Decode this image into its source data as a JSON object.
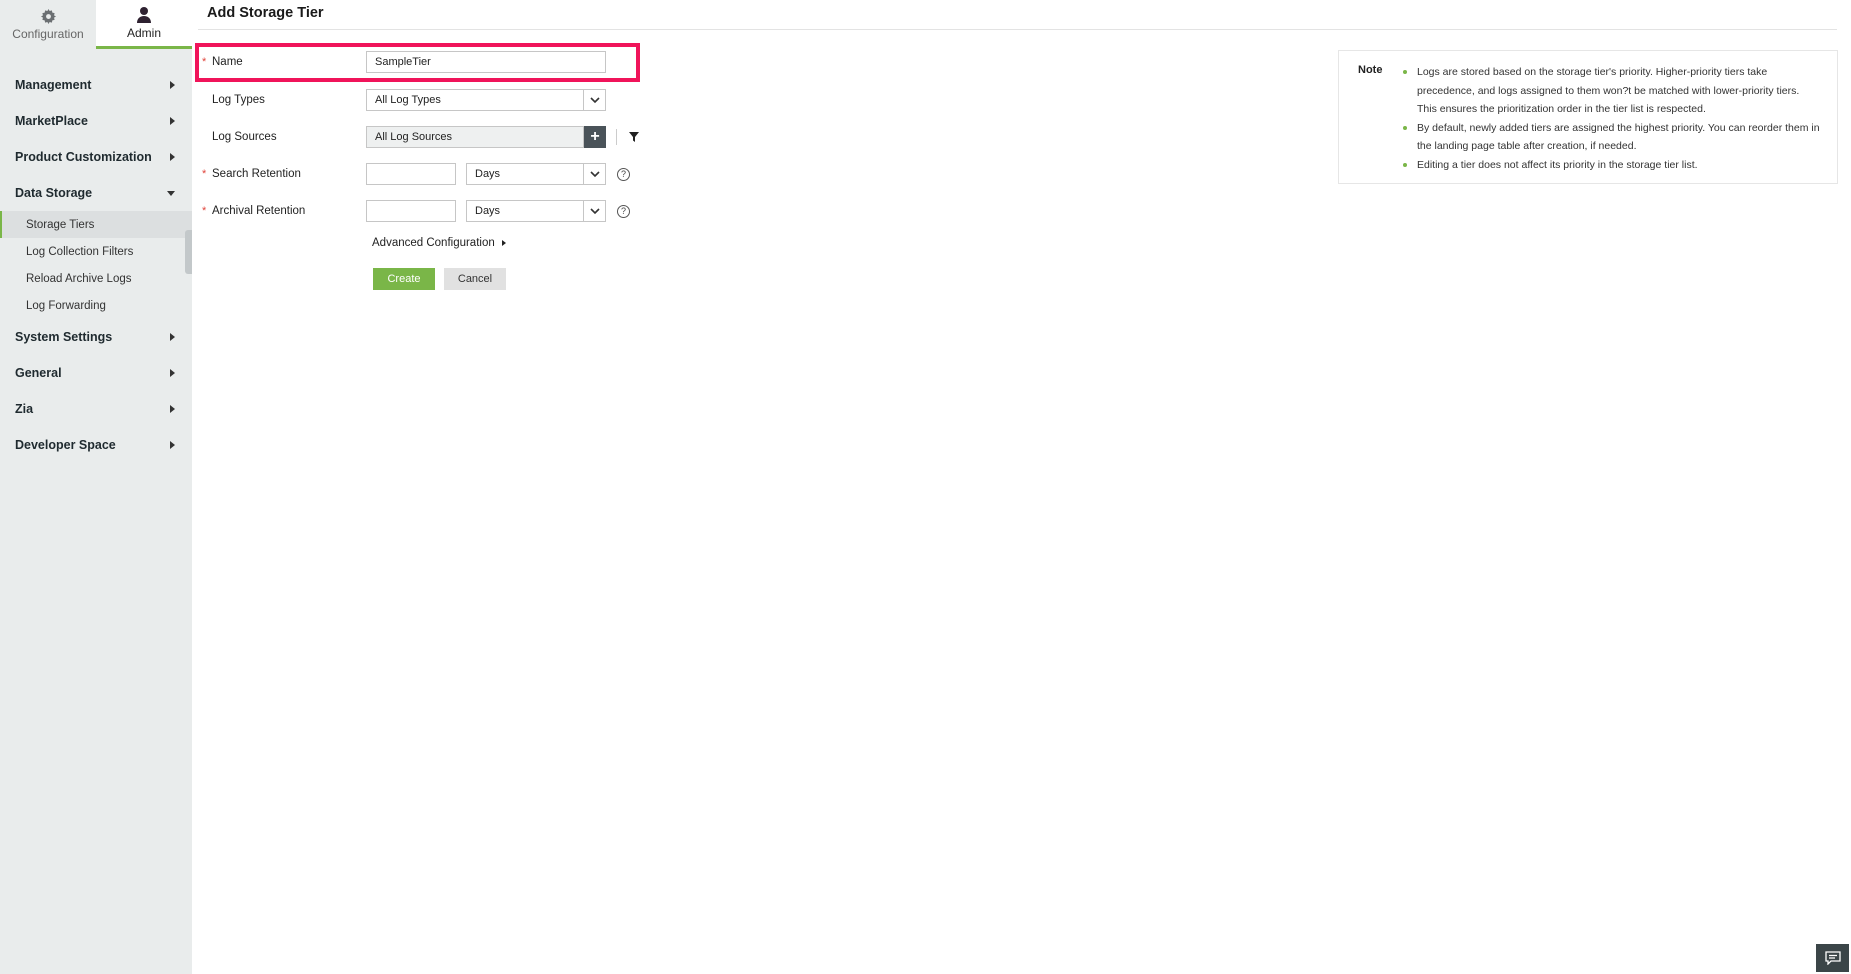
{
  "topnav": {
    "configuration_label": "Configuration",
    "admin_label": "Admin"
  },
  "sidebar": {
    "items": [
      {
        "label": "Management"
      },
      {
        "label": "MarketPlace"
      },
      {
        "label": "Product Customization"
      },
      {
        "label": "Data Storage"
      },
      {
        "label": "System Settings"
      },
      {
        "label": "General"
      },
      {
        "label": "Zia"
      },
      {
        "label": "Developer Space"
      }
    ],
    "data_storage_sub": [
      {
        "label": "Storage Tiers"
      },
      {
        "label": "Log Collection Filters"
      },
      {
        "label": "Reload Archive Logs"
      },
      {
        "label": "Log Forwarding"
      }
    ]
  },
  "page": {
    "title": "Add Storage Tier"
  },
  "form": {
    "required_mark": "*",
    "name_label": "Name",
    "name_value": "SampleTier",
    "log_types_label": "Log Types",
    "log_types_value": "All Log Types",
    "log_sources_label": "Log Sources",
    "log_sources_value": "All Log Sources",
    "search_retention_label": "Search Retention",
    "search_retention_value": "",
    "search_retention_unit": "Days",
    "archival_retention_label": "Archival Retention",
    "archival_retention_value": "",
    "archival_retention_unit": "Days",
    "advanced_config_label": "Advanced Configuration",
    "create_label": "Create",
    "cancel_label": "Cancel",
    "help_glyph": "?",
    "plus_glyph": "+"
  },
  "note": {
    "title": "Note",
    "items": [
      "Logs are stored based on the storage tier's priority. Higher-priority tiers take precedence, and logs assigned to them won?t be matched with lower-priority tiers. This ensures the prioritization order in the tier list is respected.",
      "By default, newly added tiers are assigned the highest priority. You can reorder them in the landing page table after creation, if needed.",
      "Editing a tier does not affect its priority in the storage tier list."
    ]
  },
  "icons": {
    "configuration": "gear-icon",
    "admin": "user-icon",
    "filter": "filter-icon",
    "chat": "chat-icon"
  },
  "colors": {
    "accent_green": "#7ab648",
    "highlight_pink": "#f0145a",
    "sidebar_bg": "#e9ecec"
  }
}
